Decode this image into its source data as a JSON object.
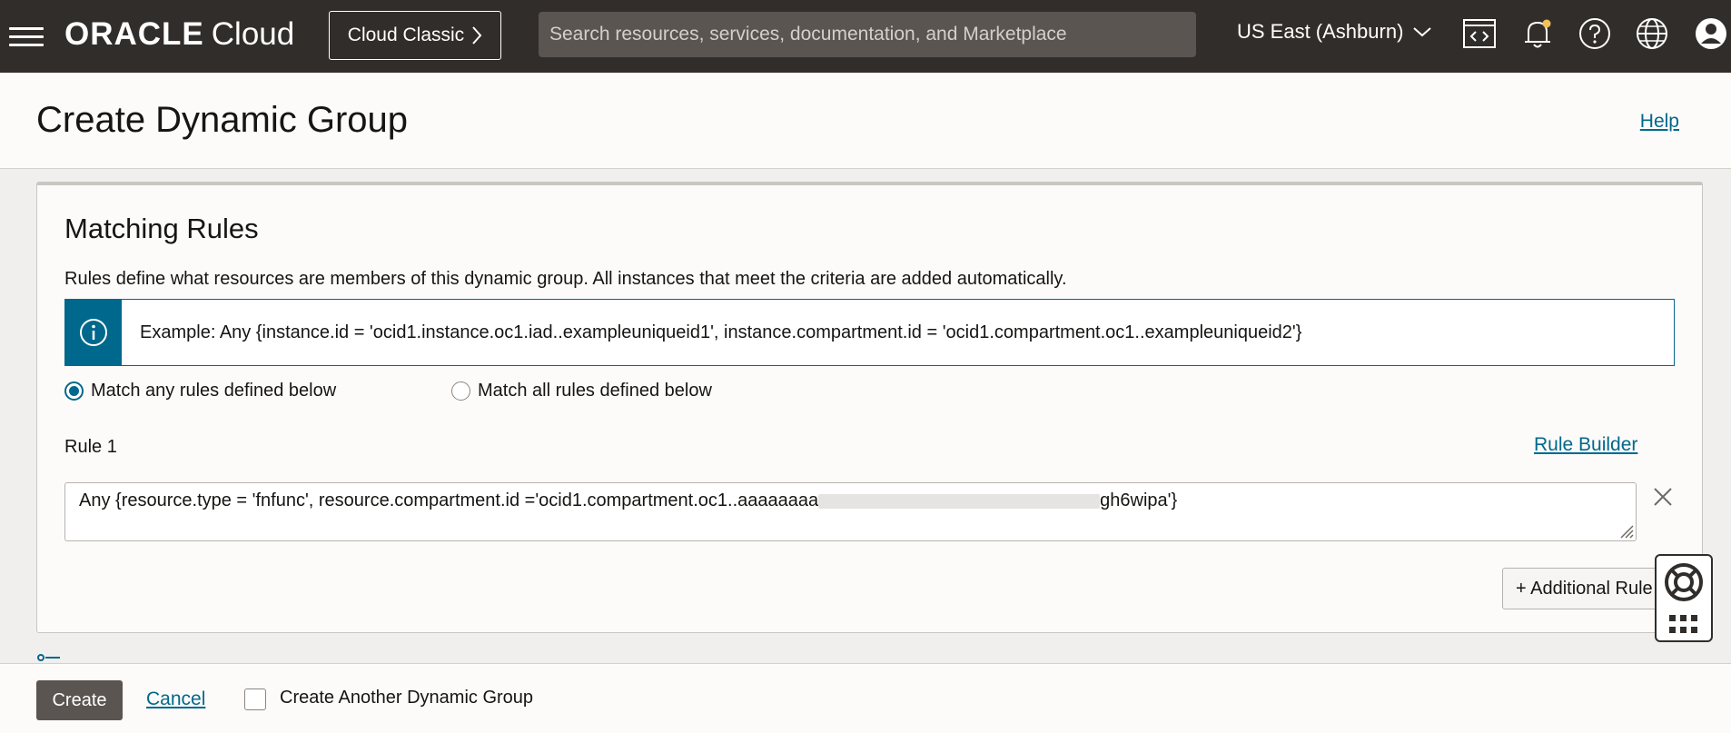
{
  "topbar": {
    "logo_brand": "ORACLE",
    "logo_product": "Cloud",
    "classic_button_label": "Cloud Classic",
    "search_placeholder": "Search resources, services, documentation, and Marketplace",
    "region_label": "US East (Ashburn)",
    "icons": [
      "code-editor-icon",
      "notifications-bell-icon",
      "help-question-icon",
      "language-globe-icon",
      "user-profile-icon"
    ]
  },
  "header": {
    "title": "Create Dynamic Group",
    "help_link": "Help"
  },
  "matching_rules": {
    "title": "Matching Rules",
    "description": "Rules define what resources are members of this dynamic group. All instances that meet the criteria are added automatically.",
    "example_text": "Example: Any {instance.id = 'ocid1.instance.oc1.iad..exampleuniqueid1', instance.compartment.id = 'ocid1.compartment.oc1..exampleuniqueid2'}",
    "radio_any_label": "Match any rules defined below",
    "radio_all_label": "Match all rules defined below",
    "selected_radio": "any",
    "rule_label": "Rule 1",
    "rule_builder_link": "Rule Builder",
    "rule_value_start": "Any {resource.type = 'fnfunc', resource.compartment.id ='ocid1.compartment.oc1..aaaaaaaa",
    "rule_value_end": "gh6wipa'}",
    "add_rule_button": "+ Additional Rule"
  },
  "footer": {
    "create_button": "Create",
    "cancel_link": "Cancel",
    "create_another_label": "Create Another Dynamic Group",
    "create_another_checked": false
  },
  "colors": {
    "topbar_bg": "#312d2a",
    "link": "#00688c",
    "primary_button": "#5a5551"
  }
}
